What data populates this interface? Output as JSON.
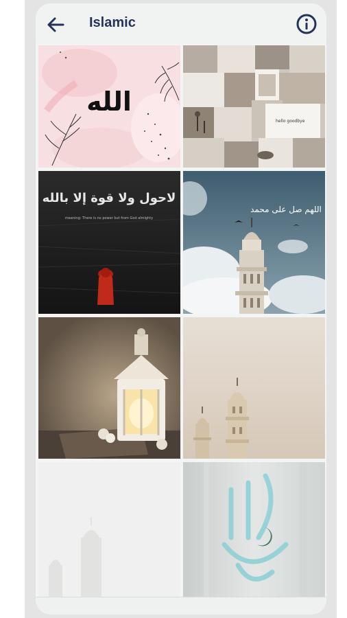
{
  "header": {
    "title": "Islamic",
    "back_icon": "arrow-left-icon",
    "info_icon": "info-circle-icon"
  },
  "wallpapers": {
    "tile1": {
      "calligraphy": "الله"
    },
    "tile2": {
      "note_text": "hello goodbye"
    },
    "tile3": {
      "calligraphy": "لاحول ولا قوة إلا بالله",
      "caption": "meaning: There is no power but from God almighty"
    },
    "tile4": {
      "text": "اللهم صل على محمد"
    }
  },
  "colors": {
    "title": "#23335a",
    "background": "#f3f5f4",
    "icon": "#23335a"
  }
}
